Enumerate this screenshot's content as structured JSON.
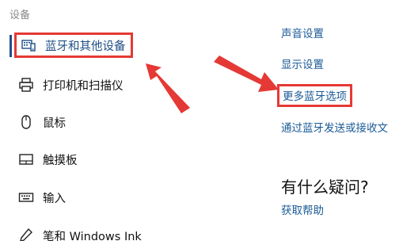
{
  "section": {
    "title": "设备"
  },
  "sidebar": {
    "items": [
      {
        "label": "蓝牙和其他设备",
        "icon": "bluetooth-devices-icon",
        "active": true
      },
      {
        "label": "打印机和扫描仪",
        "icon": "printer-icon",
        "active": false
      },
      {
        "label": "鼠标",
        "icon": "mouse-icon",
        "active": false
      },
      {
        "label": "触摸板",
        "icon": "touchpad-icon",
        "active": false
      },
      {
        "label": "输入",
        "icon": "keyboard-icon",
        "active": false
      },
      {
        "label": "笔和 Windows Ink",
        "icon": "pen-icon",
        "active": false
      }
    ]
  },
  "related": {
    "links": [
      {
        "label": "声音设置"
      },
      {
        "label": "显示设置"
      },
      {
        "label": "更多蓝牙选项",
        "highlighted": true
      },
      {
        "label": "通过蓝牙发送或接收文"
      }
    ]
  },
  "help": {
    "heading": "有什么疑问?",
    "link": "获取帮助"
  },
  "colors": {
    "accent": "#1f4f86",
    "link": "#1a5a96",
    "annotation": "#e53935"
  }
}
